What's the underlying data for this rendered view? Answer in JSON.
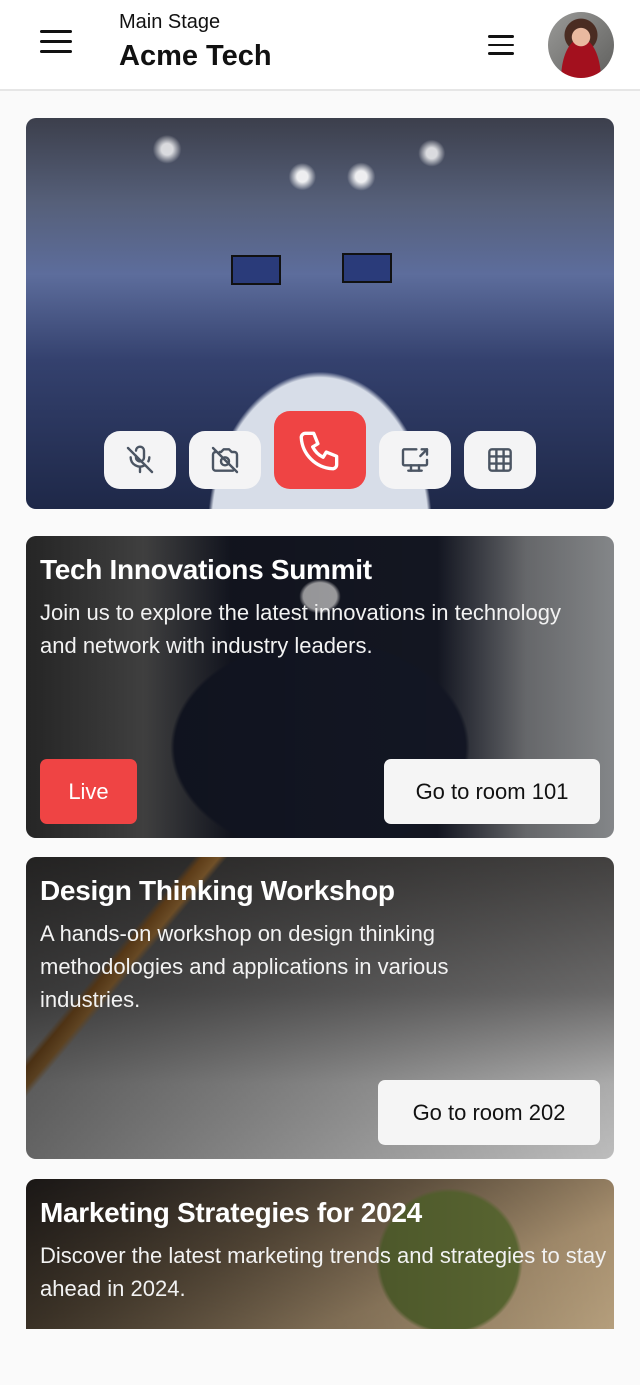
{
  "header": {
    "subtitle": "Main Stage",
    "title": "Acme Tech",
    "left_icon": "hamburger-menu-icon",
    "right_icon": "hamburger-menu-icon",
    "avatar_alt": "User avatar"
  },
  "video": {
    "controls": [
      {
        "name": "mute-microphone",
        "icon": "microphone-off-icon"
      },
      {
        "name": "turn-off-camera",
        "icon": "camera-off-icon"
      },
      {
        "name": "end-call",
        "icon": "phone-icon"
      },
      {
        "name": "share-screen",
        "icon": "screen-share-icon"
      },
      {
        "name": "grid-view",
        "icon": "grid-icon"
      }
    ],
    "end_call_color": "#ef4444"
  },
  "events": [
    {
      "title": "Tech Innovations Summit",
      "description": "Join us to explore the latest innovations in technology and network with industry leaders.",
      "badge": "Live",
      "button": "Go to room 101"
    },
    {
      "title": "Design Thinking Workshop",
      "description": "A hands-on workshop on design thinking methodologies and applications in various industries.",
      "button": "Go to room 202"
    },
    {
      "title": "Marketing Strategies for 2024",
      "description": "Discover the latest marketing trends and strategies to stay ahead in 2024."
    }
  ],
  "colors": {
    "accent": "#ef4444",
    "button_bg": "#f5f5f5",
    "page_bg": "#fafafa"
  }
}
